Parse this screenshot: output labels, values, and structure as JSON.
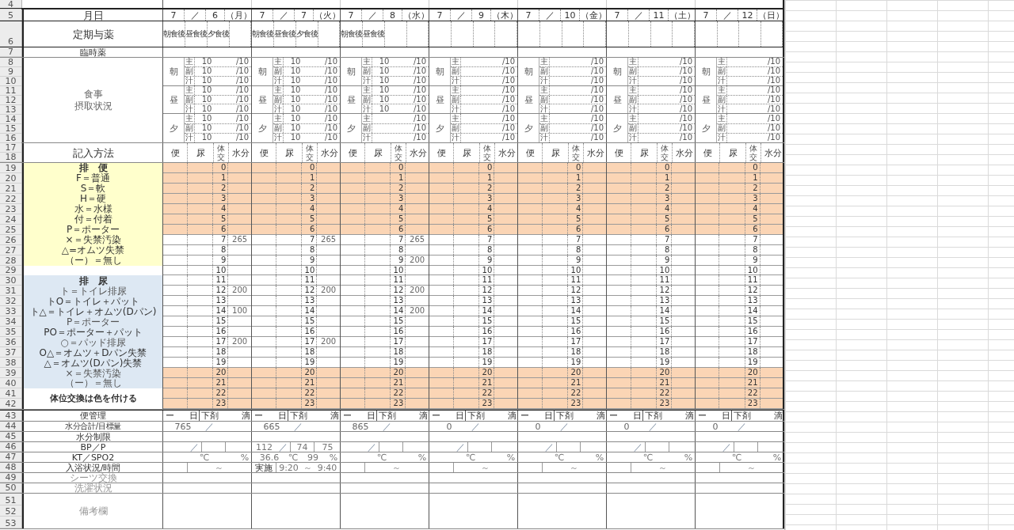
{
  "top_rows": [
    "4"
  ],
  "labels": {
    "date": {
      "rows": [
        "5"
      ],
      "text": "月日"
    },
    "doses": {
      "rows": [
        "6"
      ],
      "text": "定期与薬"
    },
    "prn": {
      "rows": [
        "7"
      ],
      "text": "臨時薬"
    },
    "meals": {
      "rows": [
        "8",
        "9",
        "10",
        "11",
        "12",
        "13",
        "14",
        "15",
        "16"
      ],
      "lines": [
        "食事",
        "摂取状況"
      ]
    },
    "method": {
      "rows": [
        "17",
        "18"
      ],
      "text": "記入方法"
    },
    "legend_rows": [
      "19",
      "20",
      "21",
      "22",
      "23",
      "24",
      "25",
      "26",
      "27",
      "28",
      "29",
      "30",
      "31",
      "32",
      "33",
      "34",
      "35",
      "36",
      "37",
      "38",
      "39",
      "40",
      "41",
      "42"
    ],
    "legend": [
      {
        "kind": "bowel-head",
        "text": "排　便"
      },
      {
        "kind": "bowel",
        "text": "F＝普通"
      },
      {
        "kind": "bowel",
        "text": "S＝軟"
      },
      {
        "kind": "bowel",
        "text": "H＝硬"
      },
      {
        "kind": "bowel",
        "text": "水＝水様"
      },
      {
        "kind": "bowel",
        "text": "付＝付着"
      },
      {
        "kind": "bowel",
        "text": "P＝ポーター"
      },
      {
        "kind": "bowel",
        "text": "×＝失禁汚染"
      },
      {
        "kind": "bowel",
        "text": "△=オムツ失禁"
      },
      {
        "kind": "bowel",
        "text": "（ー）＝無し"
      },
      {
        "kind": "blank"
      },
      {
        "kind": "urine-head",
        "text": "排　尿"
      },
      {
        "kind": "urine",
        "text": "ト＝トイレ排尿"
      },
      {
        "kind": "urine-small",
        "text": "トO＝トイレ＋パット"
      },
      {
        "kind": "urine-small",
        "text": "ト△＝トイレ＋オムツ(Dパン)"
      },
      {
        "kind": "urine",
        "text": "P＝ポーター"
      },
      {
        "kind": "urine-small",
        "text": "PO＝ポーター＋パット"
      },
      {
        "kind": "urine",
        "text": "○＝パッド排尿"
      },
      {
        "kind": "urine-small",
        "text": "O△＝オムツ＋Dパン失禁"
      },
      {
        "kind": "urine-small",
        "text": "△＝オムツ(Dパン)失禁"
      },
      {
        "kind": "urine",
        "text": "×＝失禁汚染"
      },
      {
        "kind": "urine",
        "text": "（ー）＝無し"
      },
      {
        "kind": "note",
        "text": "体位交換は色を付ける"
      }
    ],
    "bowel_mgmt": {
      "rows": [
        "43"
      ],
      "text": "便管理"
    },
    "water_total": {
      "rows": [
        "44"
      ],
      "text": "水分合計/目標量"
    },
    "water_limit": {
      "rows": [
        "45"
      ],
      "text": "水分制限"
    },
    "bp": {
      "rows": [
        "46"
      ],
      "text": "BP／P"
    },
    "vitals": {
      "rows": [
        "47"
      ],
      "text": "KT／SPO2"
    },
    "bath": {
      "rows": [
        "48"
      ],
      "text": "入浴状況/時間"
    },
    "sheets": {
      "rows": [
        "49"
      ],
      "text": "シーツ交換"
    },
    "laundry": {
      "rows": [
        "50"
      ],
      "text": "洗濯状況"
    },
    "remarks": {
      "rows": [
        "51",
        "52",
        "53"
      ],
      "text": "備考欄"
    }
  },
  "days": [
    {
      "date": {
        "month": "7",
        "sep": "／",
        "day": "6",
        "weekday": "（月）"
      },
      "doses": [
        "朝食後",
        "昼食後",
        "夕食後"
      ],
      "meals": [
        {
          "label": "朝",
          "items": [
            {
              "part": "主",
              "eaten": "10",
              "of": "/10"
            },
            {
              "part": "副",
              "eaten": "10",
              "of": "/10"
            },
            {
              "part": "汁",
              "eaten": "10",
              "of": "/10"
            }
          ]
        },
        {
          "label": "昼",
          "items": [
            {
              "part": "主",
              "eaten": "10",
              "of": "/10"
            },
            {
              "part": "副",
              "eaten": "10",
              "of": "/10"
            },
            {
              "part": "汁",
              "eaten": "10",
              "of": "/10"
            }
          ]
        },
        {
          "label": "夕",
          "items": [
            {
              "part": "主",
              "eaten": "10",
              "of": "/10"
            },
            {
              "part": "副",
              "eaten": "10",
              "of": "/10"
            },
            {
              "part": "汁",
              "eaten": "10",
              "of": "/10"
            }
          ]
        }
      ],
      "method": {
        "stool": "便",
        "urine": "尿",
        "turn": "体交",
        "water": "水分"
      },
      "hours": [
        {
          "hour": "0",
          "shaded": true
        },
        {
          "hour": "1",
          "shaded": true
        },
        {
          "hour": "2",
          "shaded": true
        },
        {
          "hour": "3",
          "shaded": true
        },
        {
          "hour": "4",
          "shaded": true
        },
        {
          "hour": "5",
          "shaded": true
        },
        {
          "hour": "6",
          "shaded": true
        },
        {
          "hour": "7",
          "water": "265",
          "shaded": false
        },
        {
          "hour": "8",
          "shaded": false
        },
        {
          "hour": "9",
          "shaded": false
        },
        {
          "hour": "10",
          "shaded": false
        },
        {
          "hour": "11",
          "shaded": false
        },
        {
          "hour": "12",
          "water": "200",
          "shaded": false
        },
        {
          "hour": "13",
          "shaded": false
        },
        {
          "hour": "14",
          "water": "100",
          "shaded": false
        },
        {
          "hour": "15",
          "shaded": false
        },
        {
          "hour": "16",
          "shaded": false
        },
        {
          "hour": "17",
          "water": "200",
          "shaded": false
        },
        {
          "hour": "18",
          "shaded": false
        },
        {
          "hour": "19",
          "shaded": false
        },
        {
          "hour": "20",
          "shaded": true
        },
        {
          "hour": "21",
          "shaded": true
        },
        {
          "hour": "22",
          "shaded": true
        },
        {
          "hour": "23",
          "shaded": true
        }
      ],
      "bowel_mgmt": [
        "ー",
        "日",
        "下剤",
        "滴"
      ],
      "water_total": {
        "amount": "765",
        "sep": "／"
      },
      "bp": {
        "sep": "／"
      },
      "vitals": {
        "temp_unit": "℃",
        "spo2_unit": "%"
      },
      "bath": {
        "tilde": "～"
      }
    },
    {
      "date": {
        "month": "7",
        "sep": "／",
        "day": "7",
        "weekday": "（火）"
      },
      "doses": [
        "朝食後",
        "昼食後",
        "夕食後"
      ],
      "meals": [
        {
          "label": "朝",
          "items": [
            {
              "part": "主",
              "eaten": "10",
              "of": "/10"
            },
            {
              "part": "副",
              "eaten": "10",
              "of": "/10"
            },
            {
              "part": "汁",
              "eaten": "10",
              "of": "/10"
            }
          ]
        },
        {
          "label": "昼",
          "items": [
            {
              "part": "主",
              "eaten": "10",
              "of": "/10"
            },
            {
              "part": "副",
              "eaten": "10",
              "of": "/10"
            },
            {
              "part": "汁",
              "eaten": "10",
              "of": "/10"
            }
          ]
        },
        {
          "label": "夕",
          "items": [
            {
              "part": "主",
              "eaten": "10",
              "of": "/10"
            },
            {
              "part": "副",
              "eaten": "10",
              "of": "/10"
            },
            {
              "part": "汁",
              "eaten": "10",
              "of": "/10"
            }
          ]
        }
      ],
      "method": {
        "stool": "便",
        "urine": "尿",
        "turn": "体交",
        "water": "水分"
      },
      "hours": [
        {
          "hour": "0",
          "shaded": true
        },
        {
          "hour": "1",
          "shaded": true
        },
        {
          "hour": "2",
          "shaded": true
        },
        {
          "hour": "3",
          "shaded": true
        },
        {
          "hour": "4",
          "shaded": true
        },
        {
          "hour": "5",
          "shaded": true
        },
        {
          "hour": "6",
          "shaded": true
        },
        {
          "hour": "7",
          "water": "265",
          "shaded": false
        },
        {
          "hour": "8",
          "shaded": false
        },
        {
          "hour": "9",
          "shaded": false
        },
        {
          "hour": "10",
          "shaded": false
        },
        {
          "hour": "11",
          "shaded": false
        },
        {
          "hour": "12",
          "water": "200",
          "shaded": false
        },
        {
          "hour": "13",
          "shaded": false
        },
        {
          "hour": "14",
          "shaded": false
        },
        {
          "hour": "15",
          "shaded": false
        },
        {
          "hour": "16",
          "shaded": false
        },
        {
          "hour": "17",
          "water": "200",
          "shaded": false
        },
        {
          "hour": "18",
          "shaded": false
        },
        {
          "hour": "19",
          "shaded": false
        },
        {
          "hour": "20",
          "shaded": true
        },
        {
          "hour": "21",
          "shaded": true
        },
        {
          "hour": "22",
          "shaded": true
        },
        {
          "hour": "23",
          "shaded": true
        }
      ],
      "bowel_mgmt": [
        "ー",
        "日",
        "下剤",
        "滴"
      ],
      "water_total": {
        "amount": "665",
        "sep": "／"
      },
      "bp": {
        "systolic": "112",
        "sep": "／",
        "diastolic": "74",
        "pulse": "75"
      },
      "vitals": {
        "temp": "36.6",
        "temp_unit": "℃",
        "spo2": "99",
        "spo2_unit": "%"
      },
      "bath": {
        "status": "実施",
        "from": "9:20",
        "tilde": "～",
        "to": "9:40"
      }
    },
    {
      "date": {
        "month": "7",
        "sep": "／",
        "day": "8",
        "weekday": "（水）"
      },
      "doses": [
        "朝食後",
        "昼食後"
      ],
      "meals": [
        {
          "label": "朝",
          "items": [
            {
              "part": "主",
              "eaten": "10",
              "of": "/10"
            },
            {
              "part": "副",
              "eaten": "10",
              "of": "/10"
            },
            {
              "part": "汁",
              "eaten": "10",
              "of": "/10"
            }
          ]
        },
        {
          "label": "昼",
          "items": [
            {
              "part": "主",
              "eaten": "10",
              "of": "/10"
            },
            {
              "part": "副",
              "eaten": "10",
              "of": "/10"
            },
            {
              "part": "汁",
              "eaten": "10",
              "of": "/10"
            }
          ]
        },
        {
          "label": "夕",
          "items": [
            {
              "part": "主",
              "of": "/10"
            },
            {
              "part": "副",
              "of": "/10"
            },
            {
              "part": "汁",
              "of": "/10"
            }
          ]
        }
      ],
      "method": {
        "stool": "便",
        "urine": "尿",
        "turn": "体交",
        "water": "水分"
      },
      "hours": [
        {
          "hour": "0",
          "shaded": true
        },
        {
          "hour": "1",
          "shaded": true
        },
        {
          "hour": "2",
          "shaded": true
        },
        {
          "hour": "3",
          "shaded": true
        },
        {
          "hour": "4",
          "shaded": true
        },
        {
          "hour": "5",
          "shaded": true
        },
        {
          "hour": "6",
          "shaded": true
        },
        {
          "hour": "7",
          "water": "265",
          "shaded": false
        },
        {
          "hour": "8",
          "shaded": false
        },
        {
          "hour": "9",
          "water": "200",
          "shaded": false
        },
        {
          "hour": "10",
          "shaded": false
        },
        {
          "hour": "11",
          "shaded": false
        },
        {
          "hour": "12",
          "water": "200",
          "shaded": false
        },
        {
          "hour": "13",
          "shaded": false
        },
        {
          "hour": "14",
          "water": "200",
          "shaded": false
        },
        {
          "hour": "15",
          "shaded": false
        },
        {
          "hour": "16",
          "shaded": false
        },
        {
          "hour": "17",
          "shaded": false
        },
        {
          "hour": "18",
          "shaded": false
        },
        {
          "hour": "19",
          "shaded": false
        },
        {
          "hour": "20",
          "shaded": true
        },
        {
          "hour": "21",
          "shaded": true
        },
        {
          "hour": "22",
          "shaded": true
        },
        {
          "hour": "23",
          "shaded": true
        }
      ],
      "bowel_mgmt": [
        "ー",
        "日",
        "下剤",
        "滴"
      ],
      "water_total": {
        "amount": "865",
        "sep": "／"
      },
      "bp": {
        "sep": "／"
      },
      "vitals": {
        "temp_unit": "℃",
        "spo2_unit": "%"
      },
      "bath": {
        "tilde": "～"
      }
    },
    {
      "date": {
        "month": "7",
        "sep": "／",
        "day": "9",
        "weekday": "（木）"
      },
      "meals": [
        {
          "label": "朝",
          "items": [
            {
              "part": "主",
              "of": "/10"
            },
            {
              "part": "副",
              "of": "/10"
            },
            {
              "part": "汁",
              "of": "/10"
            }
          ]
        },
        {
          "label": "昼",
          "items": [
            {
              "part": "主",
              "of": "/10"
            },
            {
              "part": "副",
              "of": "/10"
            },
            {
              "part": "汁",
              "of": "/10"
            }
          ]
        },
        {
          "label": "夕",
          "items": [
            {
              "part": "主",
              "of": "/10"
            },
            {
              "part": "副",
              "of": "/10"
            },
            {
              "part": "汁",
              "of": "/10"
            }
          ]
        }
      ],
      "method": {
        "stool": "便",
        "urine": "尿",
        "turn": "体交",
        "water": "水分"
      },
      "hours": [
        {
          "hour": "0",
          "shaded": true
        },
        {
          "hour": "1",
          "shaded": true
        },
        {
          "hour": "2",
          "shaded": true
        },
        {
          "hour": "3",
          "shaded": true
        },
        {
          "hour": "4",
          "shaded": true
        },
        {
          "hour": "5",
          "shaded": true
        },
        {
          "hour": "6",
          "shaded": true
        },
        {
          "hour": "7",
          "shaded": false
        },
        {
          "hour": "8",
          "shaded": false
        },
        {
          "hour": "9",
          "shaded": false
        },
        {
          "hour": "10",
          "shaded": false
        },
        {
          "hour": "11",
          "shaded": false
        },
        {
          "hour": "12",
          "shaded": false
        },
        {
          "hour": "13",
          "shaded": false
        },
        {
          "hour": "14",
          "shaded": false
        },
        {
          "hour": "15",
          "shaded": false
        },
        {
          "hour": "16",
          "shaded": false
        },
        {
          "hour": "17",
          "shaded": false
        },
        {
          "hour": "18",
          "shaded": false
        },
        {
          "hour": "19",
          "shaded": false
        },
        {
          "hour": "20",
          "shaded": true
        },
        {
          "hour": "21",
          "shaded": true
        },
        {
          "hour": "22",
          "shaded": true
        },
        {
          "hour": "23",
          "shaded": true
        }
      ],
      "bowel_mgmt": [
        "ー",
        "日",
        "下剤",
        "滴"
      ],
      "water_total": {
        "amount": "0",
        "sep": "／"
      },
      "bp": {
        "sep": "／"
      },
      "vitals": {
        "temp_unit": "℃",
        "spo2_unit": "%"
      },
      "bath": {
        "tilde": "～"
      }
    },
    {
      "date": {
        "month": "7",
        "sep": "／",
        "day": "10",
        "weekday": "（金）"
      },
      "meals": [
        {
          "label": "朝",
          "items": [
            {
              "part": "主",
              "of": "/10"
            },
            {
              "part": "副",
              "of": "/10"
            },
            {
              "part": "汁",
              "of": "/10"
            }
          ]
        },
        {
          "label": "昼",
          "items": [
            {
              "part": "主",
              "of": "/10"
            },
            {
              "part": "副",
              "of": "/10"
            },
            {
              "part": "汁",
              "of": "/10"
            }
          ]
        },
        {
          "label": "夕",
          "items": [
            {
              "part": "主",
              "of": "/10"
            },
            {
              "part": "副",
              "of": "/10"
            },
            {
              "part": "汁",
              "of": "/10"
            }
          ]
        }
      ],
      "method": {
        "stool": "便",
        "urine": "尿",
        "turn": "体交",
        "water": "水分"
      },
      "hours": [
        {
          "hour": "0",
          "shaded": true
        },
        {
          "hour": "1",
          "shaded": true
        },
        {
          "hour": "2",
          "shaded": true
        },
        {
          "hour": "3",
          "shaded": true
        },
        {
          "hour": "4",
          "shaded": true
        },
        {
          "hour": "5",
          "shaded": true
        },
        {
          "hour": "6",
          "shaded": true
        },
        {
          "hour": "7",
          "shaded": false
        },
        {
          "hour": "8",
          "shaded": false
        },
        {
          "hour": "9",
          "shaded": false
        },
        {
          "hour": "10",
          "shaded": false
        },
        {
          "hour": "11",
          "shaded": false
        },
        {
          "hour": "12",
          "shaded": false
        },
        {
          "hour": "13",
          "shaded": false
        },
        {
          "hour": "14",
          "shaded": false
        },
        {
          "hour": "15",
          "shaded": false
        },
        {
          "hour": "16",
          "shaded": false
        },
        {
          "hour": "17",
          "shaded": false
        },
        {
          "hour": "18",
          "shaded": false
        },
        {
          "hour": "19",
          "shaded": false
        },
        {
          "hour": "20",
          "shaded": true
        },
        {
          "hour": "21",
          "shaded": true
        },
        {
          "hour": "22",
          "shaded": true
        },
        {
          "hour": "23",
          "shaded": true
        }
      ],
      "bowel_mgmt": [
        "ー",
        "日",
        "下剤",
        "滴"
      ],
      "water_total": {
        "amount": "0",
        "sep": "／"
      },
      "bp": {
        "sep": "／"
      },
      "vitals": {
        "temp_unit": "℃",
        "spo2_unit": "%"
      },
      "bath": {
        "tilde": "～"
      }
    },
    {
      "date": {
        "month": "7",
        "sep": "／",
        "day": "11",
        "weekday": "（土）"
      },
      "meals": [
        {
          "label": "朝",
          "items": [
            {
              "part": "主",
              "of": "/10"
            },
            {
              "part": "副",
              "of": "/10"
            },
            {
              "part": "汁",
              "of": "/10"
            }
          ]
        },
        {
          "label": "昼",
          "items": [
            {
              "part": "主",
              "of": "/10"
            },
            {
              "part": "副",
              "of": "/10"
            },
            {
              "part": "汁",
              "of": "/10"
            }
          ]
        },
        {
          "label": "夕",
          "items": [
            {
              "part": "主",
              "of": "/10"
            },
            {
              "part": "副",
              "of": "/10"
            },
            {
              "part": "汁",
              "of": "/10"
            }
          ]
        }
      ],
      "method": {
        "stool": "便",
        "urine": "尿",
        "turn": "体交",
        "water": "水分"
      },
      "hours": [
        {
          "hour": "0",
          "shaded": true
        },
        {
          "hour": "1",
          "shaded": true
        },
        {
          "hour": "2",
          "shaded": true
        },
        {
          "hour": "3",
          "shaded": true
        },
        {
          "hour": "4",
          "shaded": true
        },
        {
          "hour": "5",
          "shaded": true
        },
        {
          "hour": "6",
          "shaded": true
        },
        {
          "hour": "7",
          "shaded": false
        },
        {
          "hour": "8",
          "shaded": false
        },
        {
          "hour": "9",
          "shaded": false
        },
        {
          "hour": "10",
          "shaded": false
        },
        {
          "hour": "11",
          "shaded": false
        },
        {
          "hour": "12",
          "shaded": false
        },
        {
          "hour": "13",
          "shaded": false
        },
        {
          "hour": "14",
          "shaded": false
        },
        {
          "hour": "15",
          "shaded": false
        },
        {
          "hour": "16",
          "shaded": false
        },
        {
          "hour": "17",
          "shaded": false
        },
        {
          "hour": "18",
          "shaded": false
        },
        {
          "hour": "19",
          "shaded": false
        },
        {
          "hour": "20",
          "shaded": true
        },
        {
          "hour": "21",
          "shaded": true
        },
        {
          "hour": "22",
          "shaded": true
        },
        {
          "hour": "23",
          "shaded": true
        }
      ],
      "bowel_mgmt": [
        "ー",
        "日",
        "下剤",
        "滴"
      ],
      "water_total": {
        "amount": "0",
        "sep": "／"
      },
      "bp": {
        "sep": "／"
      },
      "vitals": {
        "temp_unit": "℃",
        "spo2_unit": "%"
      },
      "bath": {
        "tilde": "～"
      }
    },
    {
      "date": {
        "month": "7",
        "sep": "／",
        "day": "12",
        "weekday": "（日）"
      },
      "meals": [
        {
          "label": "朝",
          "items": [
            {
              "part": "主",
              "of": "/10"
            },
            {
              "part": "副",
              "of": "/10"
            },
            {
              "part": "汁",
              "of": "/10"
            }
          ]
        },
        {
          "label": "昼",
          "items": [
            {
              "part": "主",
              "of": "/10"
            },
            {
              "part": "副",
              "of": "/10"
            },
            {
              "part": "汁",
              "of": "/10"
            }
          ]
        },
        {
          "label": "夕",
          "items": [
            {
              "part": "主",
              "of": "/10"
            },
            {
              "part": "副",
              "of": "/10"
            },
            {
              "part": "汁",
              "of": "/10"
            }
          ]
        }
      ],
      "method": {
        "stool": "便",
        "urine": "尿",
        "turn": "体交",
        "water": "水分"
      },
      "hours": [
        {
          "hour": "0",
          "shaded": true
        },
        {
          "hour": "1",
          "shaded": true
        },
        {
          "hour": "2",
          "shaded": true
        },
        {
          "hour": "3",
          "shaded": true
        },
        {
          "hour": "4",
          "shaded": true
        },
        {
          "hour": "5",
          "shaded": true
        },
        {
          "hour": "6",
          "shaded": true
        },
        {
          "hour": "7",
          "shaded": false
        },
        {
          "hour": "8",
          "shaded": false
        },
        {
          "hour": "9",
          "shaded": false
        },
        {
          "hour": "10",
          "shaded": false
        },
        {
          "hour": "11",
          "shaded": false
        },
        {
          "hour": "12",
          "shaded": false
        },
        {
          "hour": "13",
          "shaded": false
        },
        {
          "hour": "14",
          "shaded": false
        },
        {
          "hour": "15",
          "shaded": false
        },
        {
          "hour": "16",
          "shaded": false
        },
        {
          "hour": "17",
          "shaded": false
        },
        {
          "hour": "18",
          "shaded": false
        },
        {
          "hour": "19",
          "shaded": false
        },
        {
          "hour": "20",
          "shaded": true
        },
        {
          "hour": "21",
          "shaded": true
        },
        {
          "hour": "22",
          "shaded": true
        },
        {
          "hour": "23",
          "shaded": true
        }
      ],
      "bowel_mgmt": [
        "ー",
        "日",
        "下剤",
        "滴"
      ],
      "water_total": {
        "amount": "0",
        "sep": "／"
      },
      "bp": {
        "sep": "／"
      },
      "vitals": {
        "temp_unit": "℃",
        "spo2_unit": "%"
      },
      "bath": {
        "tilde": "～"
      }
    }
  ]
}
